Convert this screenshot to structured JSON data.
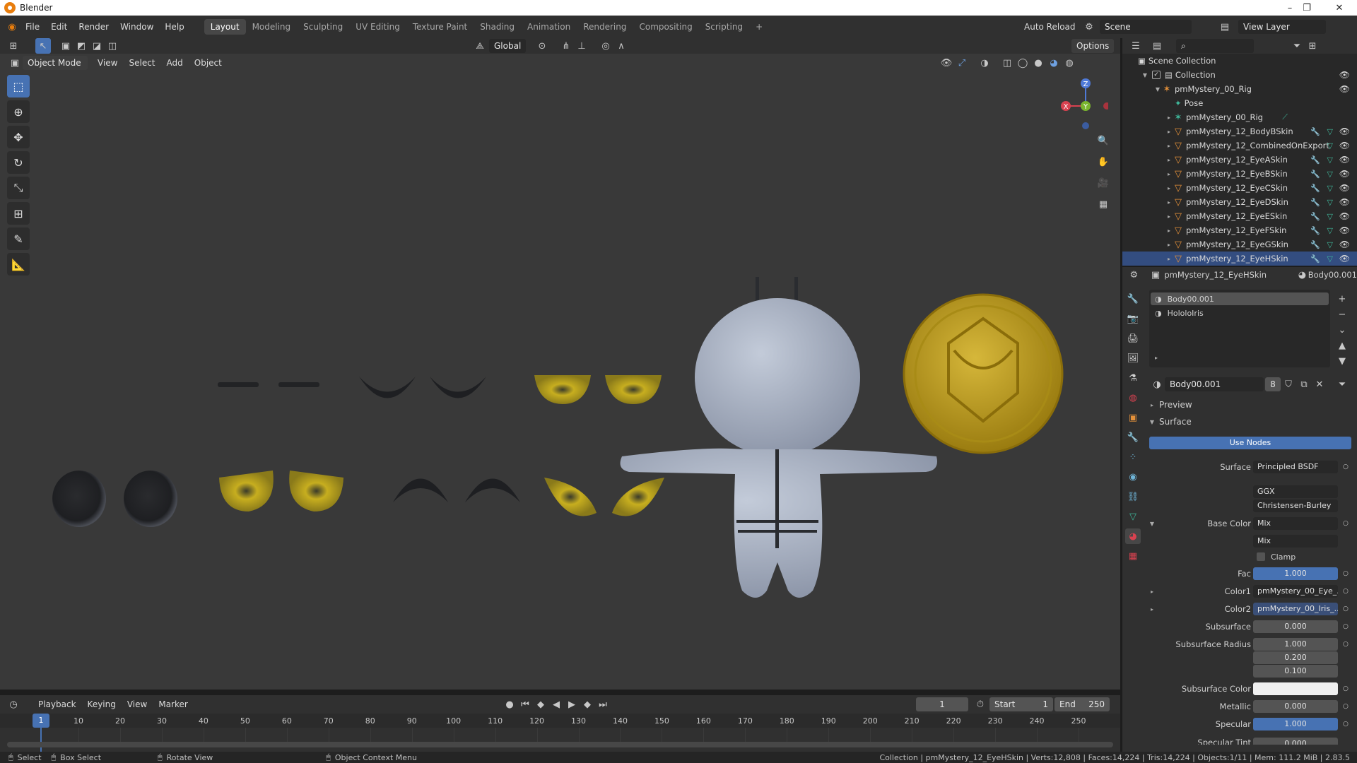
{
  "window": {
    "title": "Blender",
    "min": "–",
    "max": "❐",
    "close": "✕"
  },
  "menubar": {
    "menus": [
      "File",
      "Edit",
      "Render",
      "Window",
      "Help"
    ],
    "workspaces": [
      "Layout",
      "Modeling",
      "Sculpting",
      "UV Editing",
      "Texture Paint",
      "Shading",
      "Animation",
      "Rendering",
      "Compositing",
      "Scripting"
    ],
    "active_workspace": "Layout",
    "add_tab": "+",
    "auto_reload": "Auto Reload",
    "scene": "Scene",
    "view_layer": "View Layer"
  },
  "viewport_header": {
    "orientation": "Global",
    "options": "Options",
    "mode": "Object Mode",
    "menus": [
      "View",
      "Select",
      "Add",
      "Object"
    ]
  },
  "gizmo": {
    "x": "X",
    "y": "Y",
    "z": "Z"
  },
  "timeline": {
    "menus": [
      "Playback",
      "Keying",
      "View",
      "Marker"
    ],
    "current_frame": "1",
    "start_label": "Start",
    "start": "1",
    "end_label": "End",
    "end": "250",
    "ticks": [
      "10",
      "20",
      "30",
      "40",
      "50",
      "60",
      "70",
      "80",
      "90",
      "100",
      "110",
      "120",
      "130",
      "140",
      "150",
      "160",
      "170",
      "180",
      "190",
      "200",
      "210",
      "220",
      "230",
      "240",
      "250"
    ],
    "playhead": "1"
  },
  "statusbar": {
    "select": "Select",
    "box_select": "Box Select",
    "rotate": "Rotate View",
    "context": "Object Context Menu",
    "info": "Collection | pmMystery_12_EyeHSkin | Verts:12,808 | Faces:14,224 | Tris:14,224 | Objects:1/11 | Mem: 111.2 MiB | 2.83.5"
  },
  "outliner": {
    "scene_collection": "Scene Collection",
    "collection": "Collection",
    "rig": "pmMystery_00_Rig",
    "pose": "Pose",
    "items": [
      "pmMystery_00_Rig",
      "pmMystery_12_BodyBSkin",
      "pmMystery_12_CombinedOnExport",
      "pmMystery_12_EyeASkin",
      "pmMystery_12_EyeBSkin",
      "pmMystery_12_EyeCSkin",
      "pmMystery_12_EyeDSkin",
      "pmMystery_12_EyeESkin",
      "pmMystery_12_EyeFSkin",
      "pmMystery_12_EyeGSkin",
      "pmMystery_12_EyeHSkin"
    ]
  },
  "properties": {
    "object": "pmMystery_12_EyeHSkin",
    "material_header": "Body00.001",
    "slots": [
      "Body00.001",
      "HololoIris"
    ],
    "material_name": "Body00.001",
    "users": "8",
    "preview": "Preview",
    "surface_section": "Surface",
    "use_nodes": "Use Nodes",
    "rows": {
      "surface_label": "Surface",
      "surface": "Principled BSDF",
      "distribution": "GGX",
      "subsurface_method": "Christensen-Burley",
      "base_color_label": "Base Color",
      "base_color": "Mix",
      "blend": "Mix",
      "clamp": "Clamp",
      "fac_label": "Fac",
      "fac": "1.000",
      "color1_label": "Color1",
      "color1": "pmMystery_00_Eye_...",
      "color2_label": "Color2",
      "color2": "pmMystery_00_Iris_...",
      "subsurface_label": "Subsurface",
      "subsurface": "0.000",
      "ss_radius_label": "Subsurface Radius",
      "ss_radius": [
        "1.000",
        "0.200",
        "0.100"
      ],
      "ss_color_label": "Subsurface Color",
      "metallic_label": "Metallic",
      "metallic": "0.000",
      "specular_label": "Specular",
      "specular": "1.000",
      "specular_tint_label": "Specular Tint",
      "specular_tint": "0.000"
    }
  },
  "colors": {
    "accent": "#4772b3",
    "mesh": "#e5913a",
    "coin": "#c9a726",
    "body": "#a9b3c6"
  }
}
